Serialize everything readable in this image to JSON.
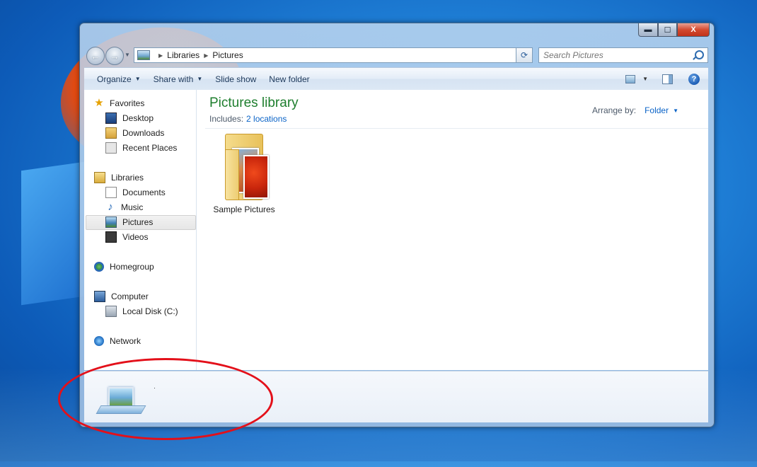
{
  "window": {
    "caption_buttons": {
      "minimize": "▬",
      "maximize": "☐",
      "close": "X"
    }
  },
  "address_bar": {
    "crumbs": [
      "Libraries",
      "Pictures"
    ]
  },
  "search": {
    "placeholder": "Search Pictures"
  },
  "command_bar": {
    "organize": "Organize",
    "share_with": "Share with",
    "slide_show": "Slide show",
    "new_folder": "New folder",
    "help": "?"
  },
  "nav_pane": {
    "favorites": "Favorites",
    "desktop": "Desktop",
    "downloads": "Downloads",
    "recent_places": "Recent Places",
    "libraries": "Libraries",
    "documents": "Documents",
    "music": "Music",
    "pictures": "Pictures",
    "videos": "Videos",
    "homegroup": "Homegroup",
    "computer": "Computer",
    "local_disk": "Local Disk (C:)",
    "network": "Network"
  },
  "content": {
    "title": "Pictures library",
    "includes_label": "Includes:",
    "includes_link": "2 locations",
    "arrange_label": "Arrange by:",
    "arrange_value": "Folder",
    "items": [
      {
        "label": "Sample Pictures"
      }
    ]
  },
  "details": {
    "mark": "·"
  },
  "colors": {
    "title_green": "#1e7e2e",
    "link_blue": "#0a63c7",
    "annotation_red": "#e3101a"
  }
}
